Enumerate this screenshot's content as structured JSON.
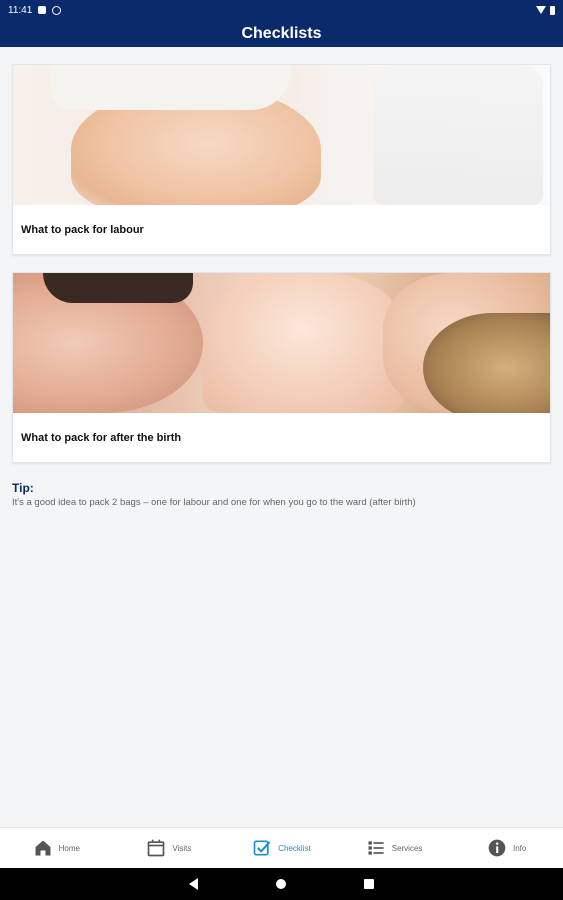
{
  "status": {
    "time": "11:41",
    "icons": [
      "sim-icon",
      "data-saver-icon",
      "wifi-icon",
      "battery-icon"
    ]
  },
  "appbar": {
    "title": "Checklists"
  },
  "cards": [
    {
      "label": "What to pack for labour",
      "image": "pregnant-belly-photo"
    },
    {
      "label": "What to pack for after the birth",
      "image": "family-newborn-photo"
    }
  ],
  "tip": {
    "title": "Tip:",
    "text": "It's a good idea to pack 2 bags – one for labour and one for when you go to the ward (after birth)"
  },
  "nav": {
    "items": [
      {
        "label": "Home",
        "icon": "home-icon"
      },
      {
        "label": "Visits",
        "icon": "calendar-icon"
      },
      {
        "label": "Checklist",
        "icon": "checkbox-icon",
        "active": true
      },
      {
        "label": "Services",
        "icon": "list-icon"
      },
      {
        "label": "Info",
        "icon": "info-icon"
      }
    ],
    "active_color": "#1b8fc6"
  },
  "colors": {
    "primary": "#0b2a6b",
    "background": "#f4f5f7"
  }
}
